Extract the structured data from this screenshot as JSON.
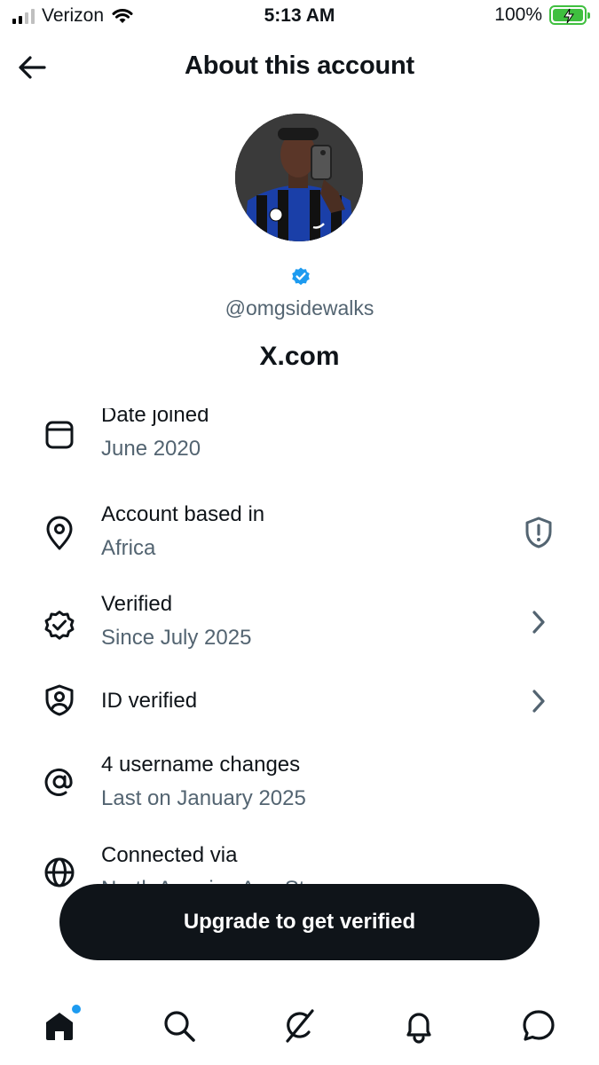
{
  "status_bar": {
    "carrier": "Verizon",
    "time": "5:13 AM",
    "battery_percent": "100%"
  },
  "header": {
    "title": "About this account"
  },
  "profile": {
    "handle": "@omgsidewalks",
    "platform": "X.com",
    "verified": true
  },
  "details": [
    {
      "title": "Date joined",
      "subtitle": "June 2020",
      "icon": "calendar-icon",
      "trailing": null
    },
    {
      "title": "Account based in",
      "subtitle": "Africa",
      "icon": "location-pin-icon",
      "trailing": "shield-alert-icon"
    },
    {
      "title": "Verified",
      "subtitle": "Since July 2025",
      "icon": "verified-check-icon",
      "trailing": "chevron-right-icon"
    },
    {
      "title": "ID verified",
      "subtitle": "",
      "icon": "id-shield-icon",
      "trailing": "chevron-right-icon"
    },
    {
      "title": "4 username changes",
      "subtitle": "Last on January 2025",
      "icon": "at-sign-icon",
      "trailing": null
    },
    {
      "title": "Connected via",
      "subtitle": "North America App Store",
      "icon": "globe-icon",
      "trailing": null
    }
  ],
  "upgrade_button": {
    "label": "Upgrade to get verified"
  },
  "tab_bar": {
    "items": [
      "home-icon",
      "search-icon",
      "grok-icon",
      "notifications-icon",
      "messages-icon"
    ],
    "home_has_badge": true
  },
  "colors": {
    "accent": "#1d9bf0",
    "text_primary": "#0f1419",
    "text_secondary": "#536471",
    "battery": "#3fbf3f"
  }
}
